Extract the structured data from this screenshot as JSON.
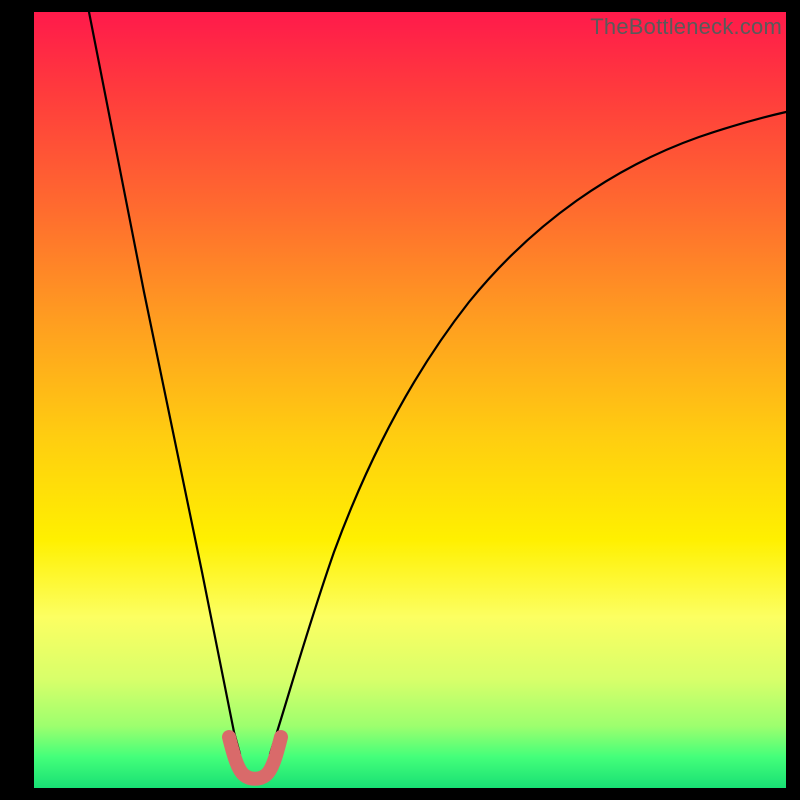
{
  "watermark": "TheBottleneck.com",
  "gradient_colors": {
    "top": "#ff1a4b",
    "upper_mid": "#ff9e20",
    "mid": "#fff000",
    "lower_mid": "#9dff6e",
    "bottom": "#18e074"
  },
  "curve_color": "#000000",
  "highlight_color": "#d96a6a",
  "chart_data": {
    "type": "line",
    "title": "",
    "xlabel": "",
    "ylabel": "",
    "xlim": [
      0,
      100
    ],
    "ylim": [
      0,
      100
    ],
    "legend": false,
    "grid": false,
    "series": [
      {
        "name": "left-branch",
        "x": [
          4,
          6,
          8,
          10,
          12,
          14,
          16,
          18,
          20,
          22,
          23.5,
          25
        ],
        "values": [
          100,
          88,
          76,
          65,
          55,
          46,
          37,
          29,
          21,
          13,
          7,
          3
        ]
      },
      {
        "name": "right-branch",
        "x": [
          29,
          31,
          34,
          38,
          43,
          49,
          56,
          64,
          73,
          82,
          91,
          100
        ],
        "values": [
          3,
          8,
          16,
          26,
          36,
          46,
          55,
          63,
          70,
          76,
          81,
          85
        ]
      },
      {
        "name": "valley-highlight",
        "x": [
          23.5,
          24.5,
          25.5,
          27,
          28.5,
          29.5,
          30.5
        ],
        "values": [
          7,
          3.5,
          2,
          1.5,
          2,
          3.5,
          7
        ]
      }
    ],
    "annotations": [
      {
        "text": "TheBottleneck.com",
        "position": "top-right"
      }
    ]
  }
}
